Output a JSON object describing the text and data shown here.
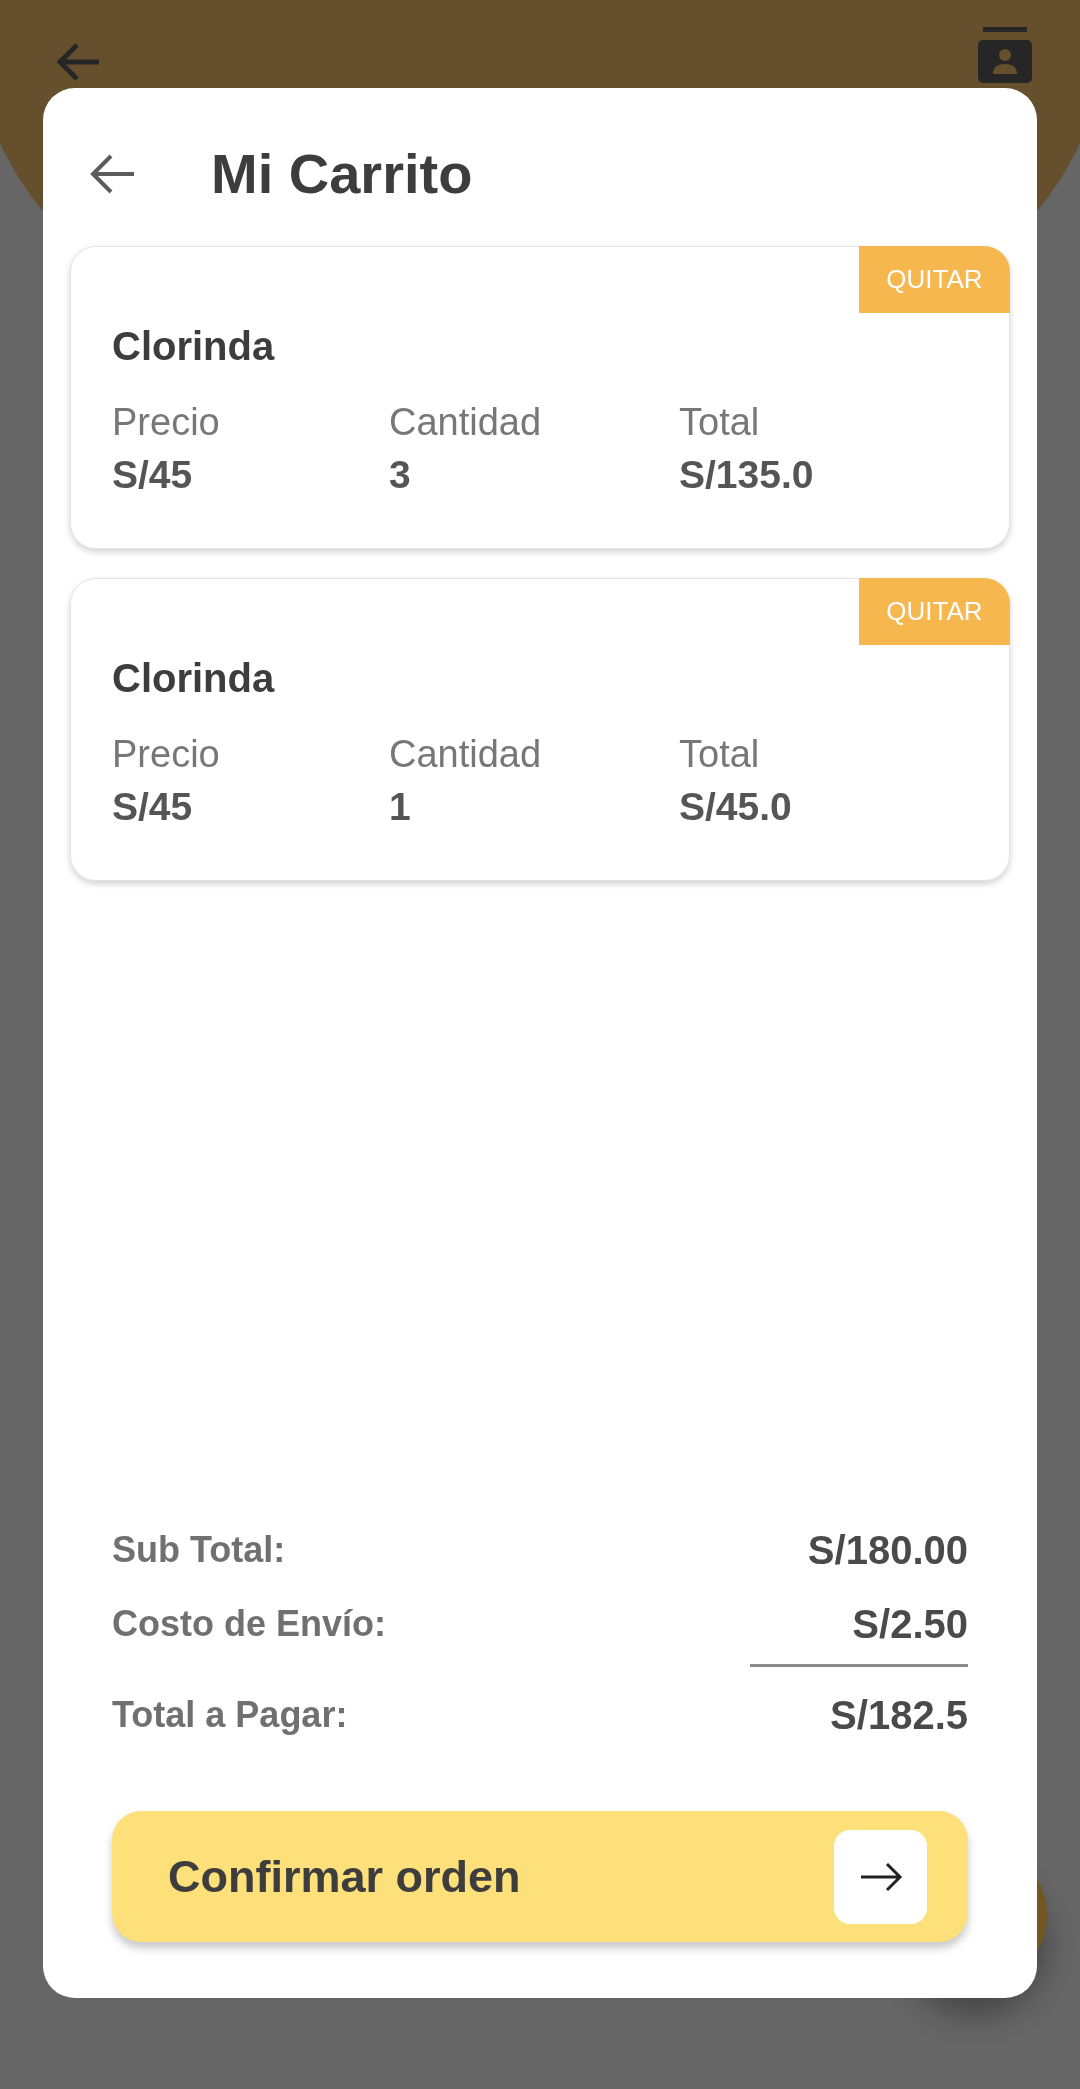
{
  "dialog": {
    "title": "Mi Carrito"
  },
  "cart_items": [
    {
      "name": "Clorinda",
      "remove_label": "QUITAR",
      "fields": [
        {
          "label": "Precio",
          "value": "S/45"
        },
        {
          "label": "Cantidad",
          "value": "3"
        },
        {
          "label": "Total",
          "value": "S/135.0"
        }
      ]
    },
    {
      "name": "Clorinda",
      "remove_label": "QUITAR",
      "fields": [
        {
          "label": "Precio",
          "value": "S/45"
        },
        {
          "label": "Cantidad",
          "value": "1"
        },
        {
          "label": "Total",
          "value": "S/45.0"
        }
      ]
    }
  ],
  "summary": [
    {
      "label": "Sub Total:",
      "value": "S/180.00"
    },
    {
      "label": "Costo de Envío:",
      "value": "S/2.50"
    },
    {
      "label": "Total a Pagar:",
      "value": "S/182.5"
    }
  ],
  "confirm_button": {
    "label": "Confirmar orden"
  }
}
